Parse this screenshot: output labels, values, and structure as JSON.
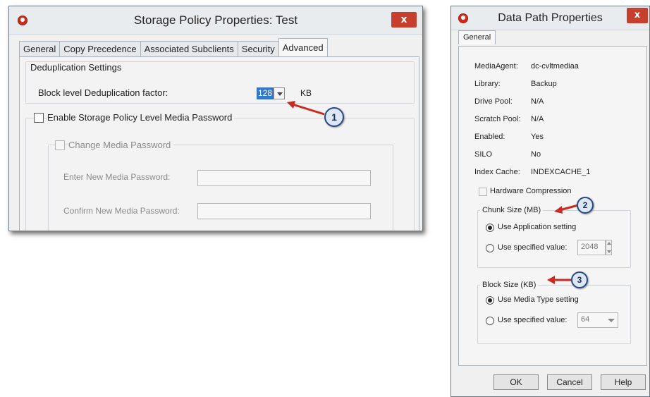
{
  "colors": {
    "close_red": "#c7402d",
    "callout_fill": "#dde6f5",
    "callout_border": "#274a86",
    "arrow_red": "#cc2a20",
    "selection_blue": "#3477c9"
  },
  "storage_policy": {
    "title": "Storage Policy Properties: Test",
    "close_label": "x",
    "tabs": [
      {
        "label": "General",
        "active": false
      },
      {
        "label": "Copy Precedence",
        "active": false
      },
      {
        "label": "Associated Subclients",
        "active": false
      },
      {
        "label": "Security",
        "active": false
      },
      {
        "label": "Advanced",
        "active": true
      }
    ],
    "dedup_group_label": "Deduplication Settings",
    "block_factor_label": "Block level Deduplication factor:",
    "block_factor_value": "128",
    "block_factor_unit": "KB",
    "enable_media_password_label": "Enable Storage Policy Level Media Password",
    "change_media_password_label": "Change Media Password",
    "new_password_label": "Enter New Media Password:",
    "confirm_password_label": "Confirm New Media Password:",
    "new_password_value": "",
    "confirm_password_value": "",
    "callout_1": "1"
  },
  "data_path": {
    "title": "Data Path Properties",
    "close_label": "x",
    "tab_label": "General",
    "properties": [
      {
        "label": "MediaAgent:",
        "value": "dc-cvltmediaa"
      },
      {
        "label": "Library:",
        "value": "Backup"
      },
      {
        "label": "Drive Pool:",
        "value": "N/A"
      },
      {
        "label": "Scratch Pool:",
        "value": "N/A"
      },
      {
        "label": "Enabled:",
        "value": "Yes"
      },
      {
        "label": "SILO",
        "value": "No"
      },
      {
        "label": "Index Cache:",
        "value": "INDEXCACHE_1"
      }
    ],
    "hardware_compression_label": "Hardware Compression",
    "chunk_size_label": "Chunk Size (MB)",
    "chunk_use_app_label": "Use Application setting",
    "chunk_use_specified_label": "Use specified value:",
    "chunk_value": "2048",
    "block_size_label": "Block Size (KB)",
    "block_use_media_label": "Use Media Type setting",
    "block_use_specified_label": "Use specified value:",
    "block_value": "64",
    "callout_2": "2",
    "callout_3": "3",
    "ok_label": "OK",
    "cancel_label": "Cancel",
    "help_label": "Help"
  }
}
